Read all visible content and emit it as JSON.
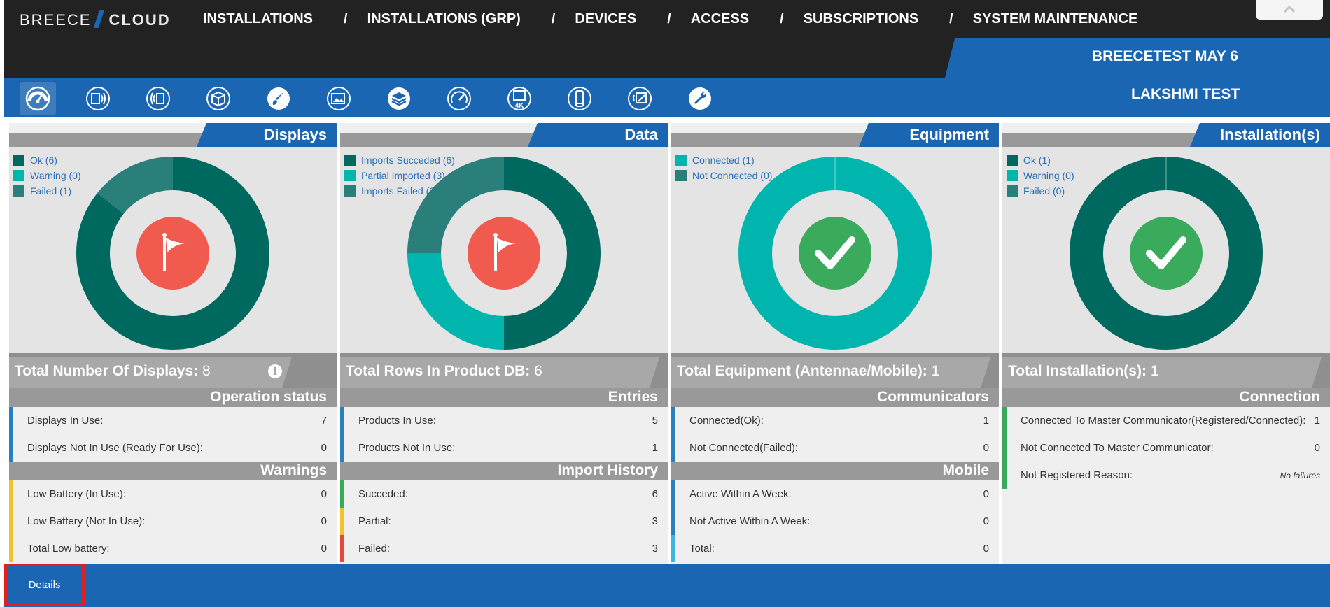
{
  "brand": {
    "left": "BREECE",
    "right": "CLOUD"
  },
  "nav": [
    {
      "label": "INSTALLATIONS"
    },
    {
      "label": "INSTALLATIONS (GRP)"
    },
    {
      "label": "DEVICES"
    },
    {
      "label": "ACCESS"
    },
    {
      "label": "SUBSCRIPTIONS"
    },
    {
      "label": "SYSTEM MAINTENANCE"
    }
  ],
  "nav_separator": "/",
  "header": {
    "installation": "BREECETEST MAY 6",
    "context": "LAKSHMI TEST"
  },
  "toolbar_icons": [
    "dashboard-icon",
    "antenna-icon",
    "communicator-icon",
    "package-icon",
    "brush-icon",
    "images-icon",
    "layers-icon",
    "gauge-icon",
    "monitor-4k-icon",
    "mobile-phone-icon",
    "signal-edit-icon",
    "wrench-icon"
  ],
  "colors": {
    "dark_teal": "#00695f",
    "teal": "#00b5ad",
    "mid_teal": "#2b7f7a",
    "blue": "#1a66b3",
    "red": "#f05a4f",
    "green": "#3aaa5c"
  },
  "panels": [
    {
      "title": "Displays",
      "legend": [
        {
          "label": "Ok (6)",
          "color": "#00695f"
        },
        {
          "label": "Warning (0)",
          "color": "#00b5ad"
        },
        {
          "label": "Failed (1)",
          "color": "#2b7f7a"
        }
      ],
      "donut": [
        {
          "value": 6,
          "color": "#00695f"
        },
        {
          "value": 0,
          "color": "#00b5ad"
        },
        {
          "value": 1,
          "color": "#2b7f7a"
        }
      ],
      "status_icon": "flag-icon",
      "total_label": "Total Number Of Displays:",
      "total_value": "8",
      "sections": [
        {
          "title": "Operation status",
          "rows": [
            {
              "label": "Displays In Use:",
              "value": "7",
              "color": "#2a7fbd"
            },
            {
              "label": "Displays Not In Use (Ready For Use):",
              "value": "0",
              "color": "#2a7fbd"
            }
          ]
        },
        {
          "title": "Warnings",
          "rows": [
            {
              "label": "Low Battery (In Use):",
              "value": "0",
              "color": "#f2c12e"
            },
            {
              "label": "Low Battery (Not In Use):",
              "value": "0",
              "color": "#f2c12e"
            },
            {
              "label": "Total Low battery:",
              "value": "0",
              "color": "#f2c12e"
            }
          ]
        }
      ]
    },
    {
      "title": "Data",
      "legend": [
        {
          "label": "Imports Succeded (6)",
          "color": "#00695f"
        },
        {
          "label": "Partial Imported (3)",
          "color": "#00b5ad"
        },
        {
          "label": "Imports Failed (3)",
          "color": "#2b7f7a"
        }
      ],
      "donut": [
        {
          "value": 6,
          "color": "#00695f"
        },
        {
          "value": 3,
          "color": "#00b5ad"
        },
        {
          "value": 3,
          "color": "#2b7f7a"
        }
      ],
      "status_icon": "flag-icon",
      "total_label": "Total Rows In Product DB:",
      "total_value": "6",
      "sections": [
        {
          "title": "Entries",
          "rows": [
            {
              "label": "Products In Use:",
              "value": "5",
              "color": "#2a7fbd"
            },
            {
              "label": "Products Not In Use:",
              "value": "1",
              "color": "#2a7fbd"
            }
          ]
        },
        {
          "title": "Import History",
          "rows": [
            {
              "label": "Succeded:",
              "value": "6",
              "color": "#3aaa5c"
            },
            {
              "label": "Partial:",
              "value": "3",
              "color": "#f2c12e"
            },
            {
              "label": "Failed:",
              "value": "3",
              "color": "#e8473d"
            }
          ]
        }
      ]
    },
    {
      "title": "Equipment",
      "legend": [
        {
          "label": "Connected (1)",
          "color": "#00b5ad"
        },
        {
          "label": "Not Connected (0)",
          "color": "#2b7f7a"
        }
      ],
      "donut": [
        {
          "value": 1,
          "color": "#00b5ad"
        },
        {
          "value": 0,
          "color": "#2b7f7a"
        }
      ],
      "status_icon": "check-icon",
      "total_label": "Total Equipment (Antennae/Mobile):",
      "total_value": "1",
      "sections": [
        {
          "title": "Communicators",
          "rows": [
            {
              "label": "Connected(Ok):",
              "value": "1",
              "color": "#2a7fbd"
            },
            {
              "label": "Not Connected(Failed):",
              "value": "0",
              "color": "#2a7fbd"
            }
          ]
        },
        {
          "title": "Mobile",
          "rows": [
            {
              "label": "Active Within A Week:",
              "value": "0",
              "color": "#2a7fbd"
            },
            {
              "label": "Not Active Within A Week:",
              "value": "0",
              "color": "#2a7fbd"
            },
            {
              "label": "Total:",
              "value": "0",
              "color": "#3fb6e0"
            }
          ]
        }
      ]
    },
    {
      "title": "Installation(s)",
      "legend": [
        {
          "label": "Ok (1)",
          "color": "#00695f"
        },
        {
          "label": "Warning (0)",
          "color": "#00b5ad"
        },
        {
          "label": "Failed (0)",
          "color": "#2b7f7a"
        }
      ],
      "donut": [
        {
          "value": 1,
          "color": "#00695f"
        },
        {
          "value": 0,
          "color": "#00b5ad"
        },
        {
          "value": 0,
          "color": "#2b7f7a"
        }
      ],
      "status_icon": "check-icon",
      "total_label": "Total Installation(s):",
      "total_value": "1",
      "sections": [
        {
          "title": "Connection",
          "rows": [
            {
              "label": "Connected To Master Communicator(Registered/Connected):",
              "value": "1",
              "color": "#3aaa5c"
            },
            {
              "label": "Not Connected To Master Communicator:",
              "value": "0",
              "color": "#3aaa5c"
            },
            {
              "label": "Not Registered Reason:",
              "value": "No failures",
              "color": "#3aaa5c",
              "italic": true
            }
          ]
        }
      ]
    }
  ],
  "footer": {
    "details_label": "Details"
  }
}
